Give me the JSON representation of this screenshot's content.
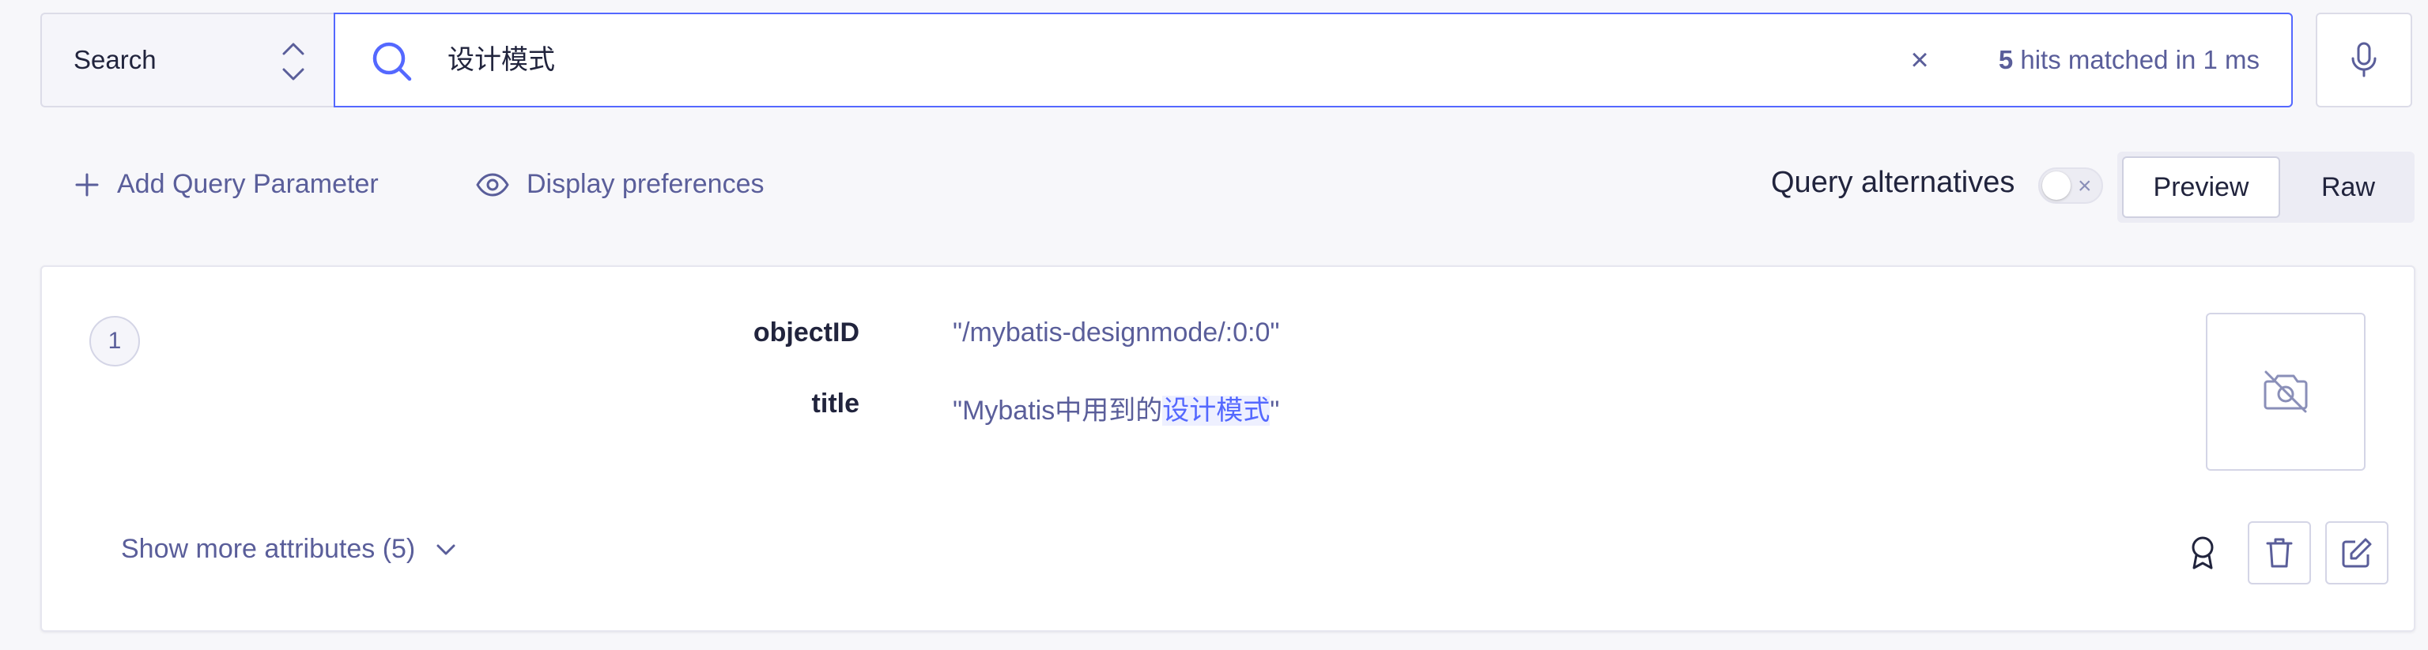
{
  "search": {
    "index_label": "Search",
    "query": "设计模式",
    "clear_symbol": "×",
    "hits_count": "5",
    "hits_suffix": "hits matched in 1 ms"
  },
  "toolbar": {
    "add_param_label": "Add Query Parameter",
    "display_prefs_label": "Display preferences",
    "query_alternatives_label": "Query alternatives",
    "query_alternatives_enabled": false,
    "toggle_symbol": "×",
    "view_options": [
      "Preview",
      "Raw"
    ],
    "active_view": "Preview"
  },
  "hit": {
    "number": "1",
    "attributes": [
      {
        "key": "objectID",
        "value": "\"/mybatis-designmode/:0:0\""
      },
      {
        "key": "title",
        "value_prefix": "\"Mybatis中用到的",
        "value_highlight": "设计模式",
        "value_suffix": "\""
      }
    ],
    "show_more_label": "Show more attributes (5)",
    "icons": {
      "image_placeholder": "camera-off-icon",
      "ranking": "award-icon",
      "delete": "trash-icon",
      "edit": "edit-icon"
    }
  },
  "colors": {
    "accent": "#5468ff",
    "text_muted": "#5a5e9a",
    "text_dark": "#21243d",
    "background": "#f7f7fa",
    "highlight_bg": "#eef0ff"
  }
}
